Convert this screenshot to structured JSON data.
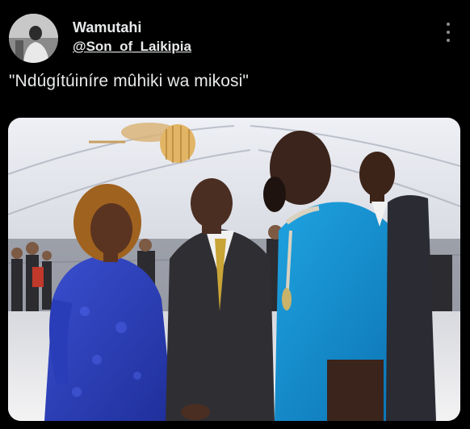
{
  "tweet": {
    "author": {
      "display_name": "Wamutahi",
      "handle": "@Son_of_Laikipia",
      "avatar_icon": "profile-avatar"
    },
    "text": "\"Ndúgítúiníre mûhiki wa mikosi\"",
    "menu_icon": "more-options-icon",
    "colors": {
      "background": "#000000",
      "text": "#e7e9ea",
      "muted": "#8b8f94"
    },
    "media": {
      "type": "photo",
      "description_icon": "event-photo"
    }
  }
}
